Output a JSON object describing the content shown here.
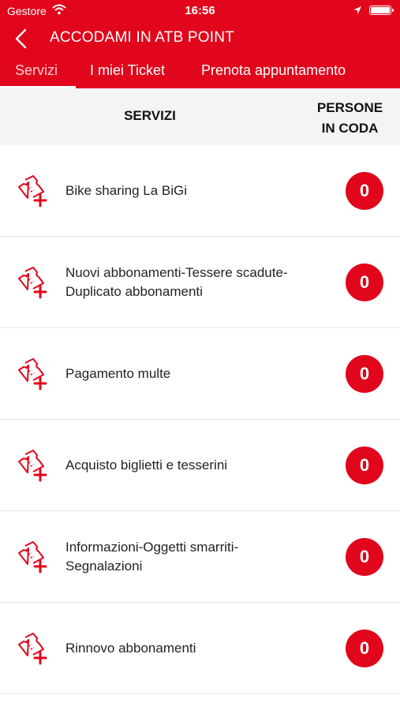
{
  "status_bar": {
    "carrier": "Gestore",
    "time": "16:56"
  },
  "navbar": {
    "title": "ACCODAMI IN ATB POINT",
    "back_icon": "chevron-left-icon"
  },
  "tabs": [
    {
      "label": "Servizi",
      "active": true
    },
    {
      "label": "I miei Ticket",
      "active": false
    },
    {
      "label": "Prenota appuntamento",
      "active": false
    }
  ],
  "columns": {
    "services": "SERVIZI",
    "queue_line1": "PERSONE",
    "queue_line2": "IN CODA"
  },
  "services": [
    {
      "lines": [
        "Bike sharing La BiGi"
      ],
      "queue": "0"
    },
    {
      "lines": [
        "Nuovi abbonamenti-Tessere scadute-",
        "Duplicato abbonamenti"
      ],
      "queue": "0"
    },
    {
      "lines": [
        "Pagamento multe"
      ],
      "queue": "0"
    },
    {
      "lines": [
        "Acquisto biglietti e tesserini"
      ],
      "queue": "0"
    },
    {
      "lines": [
        "Informazioni-Oggetti smarriti-",
        "Segnalazioni"
      ],
      "queue": "0"
    },
    {
      "lines": [
        "Rinnovo abbonamenti"
      ],
      "queue": "0"
    }
  ],
  "colors": {
    "brand_red": "#e1061b",
    "header_bg": "#f4f4f4"
  },
  "icons": {
    "service_icon": "ticket-add-icon"
  }
}
